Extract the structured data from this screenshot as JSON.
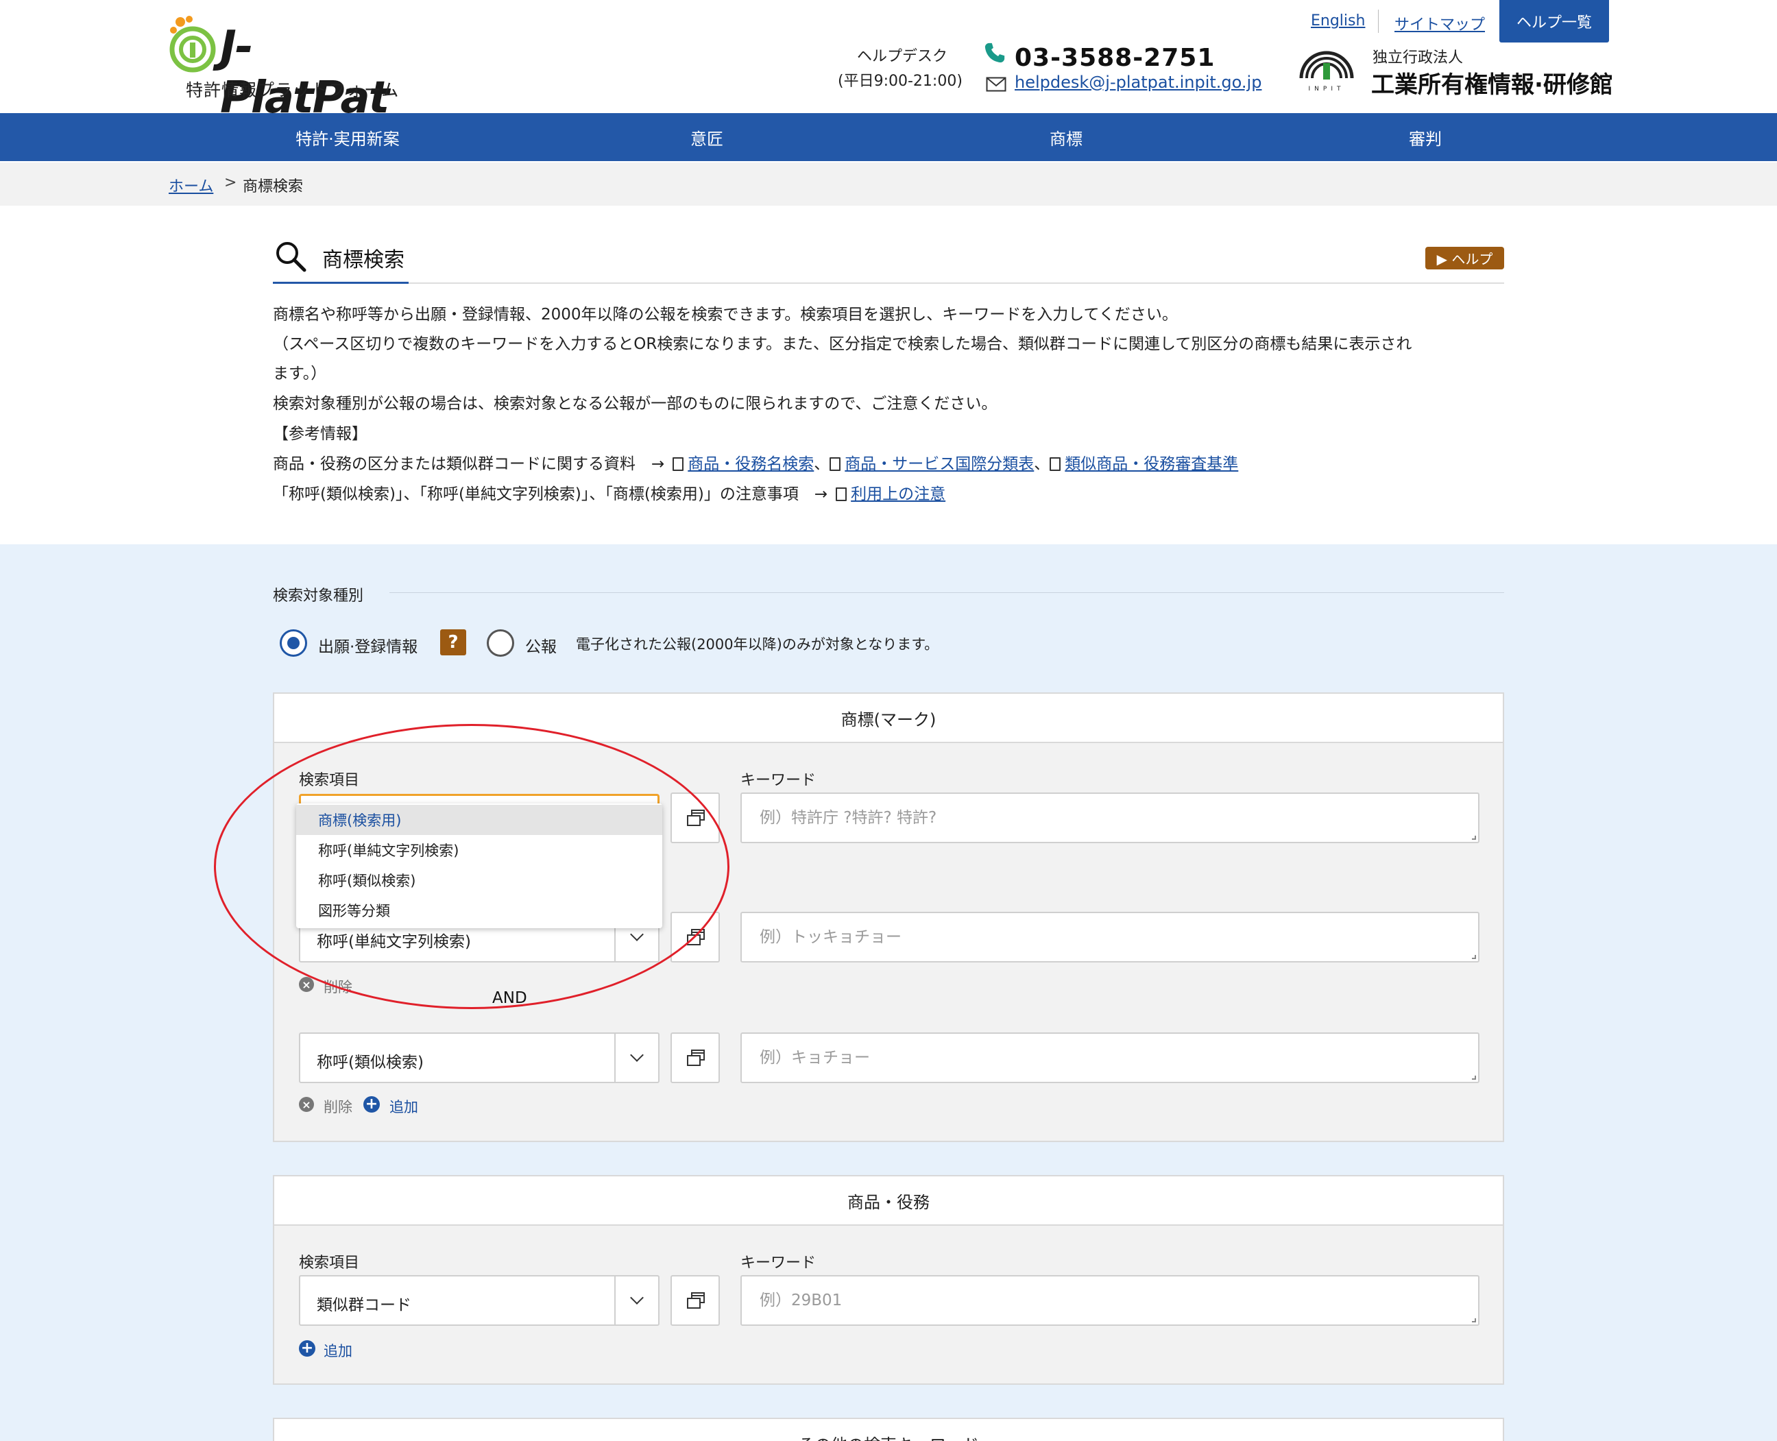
{
  "header": {
    "logo_text": "J-PlatPat",
    "logo_sub": "特許情報プラットフォーム",
    "helpdesk_label": "ヘルプデスク",
    "helpdesk_hours": "(平日9:00-21:00)",
    "phone": "03-3588-2751",
    "email": "helpdesk@j-platpat.inpit.go.jp",
    "link_english": "English",
    "link_sitemap": "サイトマップ",
    "help_list": "ヘルプ一覧",
    "inpit_small": "独立行政法人",
    "inpit_big": "工業所有権情報·研修館",
    "inpit_mark_text": "INPIT"
  },
  "nav": [
    "特許·実用新案",
    "意匠",
    "商標",
    "審判"
  ],
  "breadcrumb": {
    "home": "ホーム",
    "separator": ">",
    "current": "商標検索"
  },
  "intro": {
    "title": "商標検索",
    "help_button": "▶ ヘルプ",
    "line1": "商標名や称呼等から出願・登録情報、2000年以降の公報を検索できます。検索項目を選択し、キーワードを入力してください。",
    "line2": "（スペース区切りで複数のキーワードを入力するとOR検索になります。また、区分指定で検索した場合、類似群コードに関連して別区分の商標も結果に表示され",
    "line3": "ます。）",
    "line4": "検索対象種別が公報の場合は、検索対象となる公報が一部のものに限られますので、ご注意ください。",
    "line5": "【参考情報】",
    "line6_prefix": "商品・役務の区分または類似群コードに関する資料　→",
    "link_goods_search": "商品・役務名検索",
    "link_intl_class": "商品・サービス国際分類表",
    "link_exam_std": "類似商品・役務審査基準",
    "sep_comma": "、",
    "line7_prefix": "「称呼(類似検索)」、「称呼(単純文字列検索)」、「商標(検索用)」の注意事項　→",
    "link_usage_notes": "利用上の注意"
  },
  "search_target": {
    "label": "検索対象種別",
    "option1": "出願·登録情報",
    "option1_selected": true,
    "help_badge": "?",
    "option2": "公報",
    "option2_note": "電子化された公報(2000年以降)のみが対象となります。"
  },
  "mark_panel": {
    "title": "商標(マーク)",
    "item_label": "検索項目",
    "keyword_label": "キーワード",
    "dropdown_options": [
      "商標(検索用)",
      "称呼(単純文字列検索)",
      "称呼(類似検索)",
      "図形等分類"
    ],
    "dropdown_selected_index": 0,
    "row2_select": "称呼(単純文字列検索)",
    "row3_select": "称呼(類似検索)",
    "row1_placeholder": "例）特許庁 ?特許? 特許?",
    "row2_placeholder": "例）トッキョチョー",
    "row3_placeholder": "例）キョチョー",
    "delete_label": "削除",
    "add_label": "追加",
    "and_label": "AND"
  },
  "goods_panel": {
    "title": "商品・役務",
    "item_label": "検索項目",
    "keyword_label": "キーワード",
    "select_value": "類似群コード",
    "placeholder": "例）29B01",
    "add_label": "追加"
  },
  "other_panel": {
    "title": "その他の検索キーワード"
  },
  "colors": {
    "nav": "#2358a8",
    "accent_brown": "#9c5a12",
    "annotation_red": "#e0202a",
    "search_bg": "#e7f1fb"
  }
}
